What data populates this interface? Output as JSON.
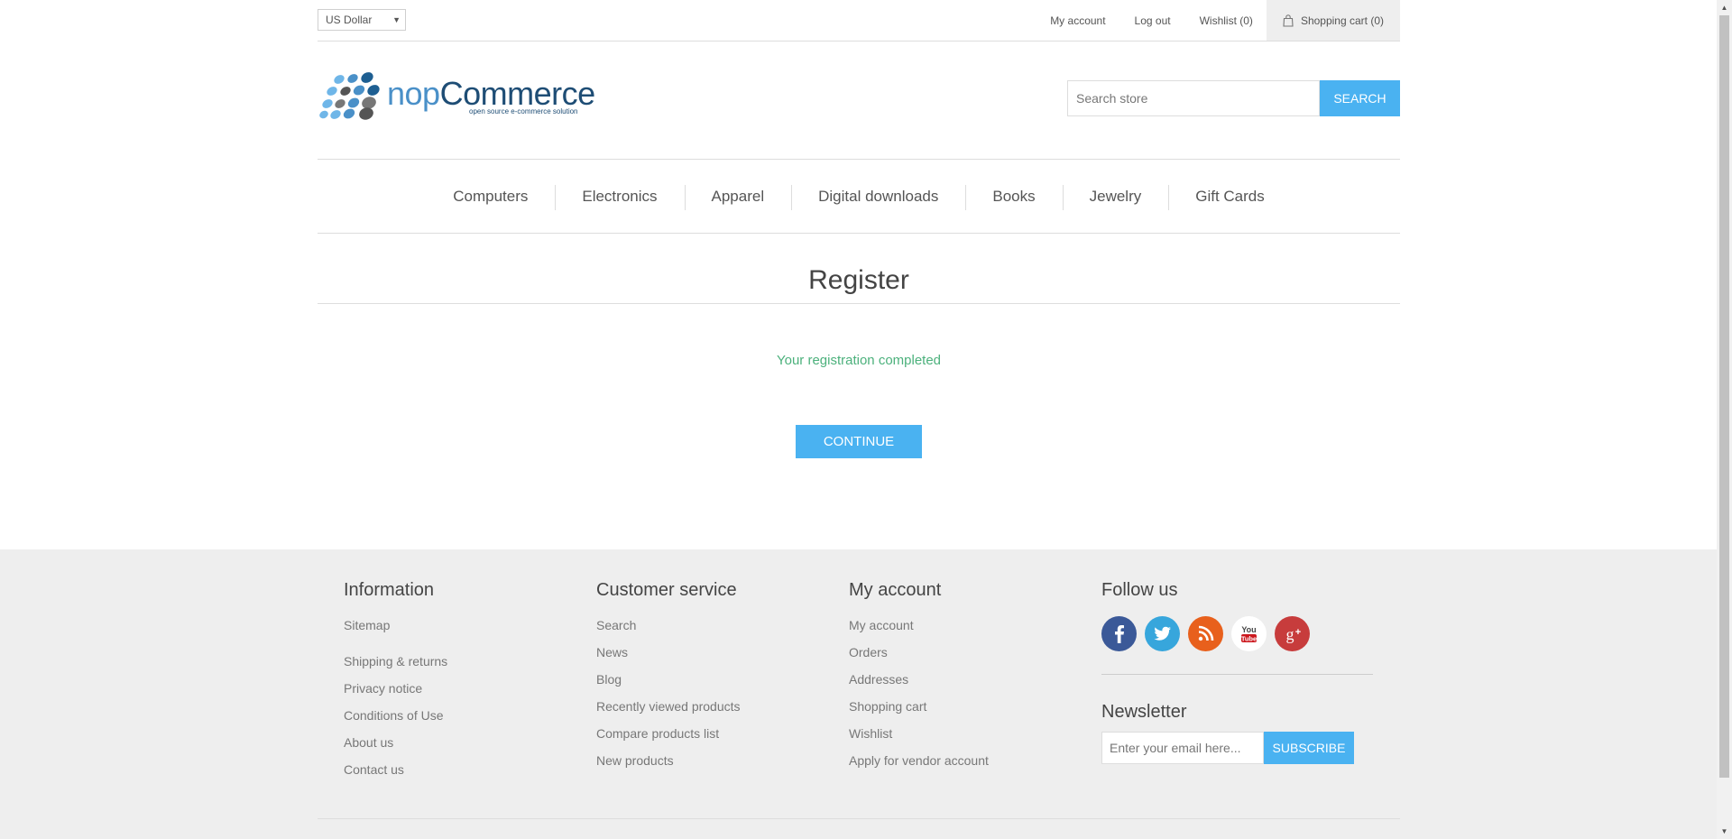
{
  "header": {
    "currency": "US Dollar",
    "links": {
      "my_account": "My account",
      "log_out": "Log out",
      "wishlist": "Wishlist (0)",
      "shopping_cart": "Shopping cart (0)"
    }
  },
  "logo": {
    "brand_prefix": "nop",
    "brand_suffix": "Commerce",
    "tagline": "open source e-commerce solution"
  },
  "search": {
    "placeholder": "Search store",
    "button": "Search"
  },
  "menu": [
    "Computers",
    "Electronics",
    "Apparel",
    "Digital downloads",
    "Books",
    "Jewelry",
    "Gift Cards"
  ],
  "page": {
    "title": "Register",
    "result": "Your registration completed",
    "continue_button": "Continue"
  },
  "footer": {
    "information": {
      "title": "Information",
      "links": [
        "Sitemap",
        "Shipping & returns",
        "Privacy notice",
        "Conditions of Use",
        "About us",
        "Contact us"
      ]
    },
    "customer_service": {
      "title": "Customer service",
      "links": [
        "Search",
        "News",
        "Blog",
        "Recently viewed products",
        "Compare products list",
        "New products"
      ]
    },
    "my_account": {
      "title": "My account",
      "links": [
        "My account",
        "Orders",
        "Addresses",
        "Shopping cart",
        "Wishlist",
        "Apply for vendor account"
      ]
    },
    "follow_us": {
      "title": "Follow us",
      "icons": [
        "facebook-icon",
        "twitter-icon",
        "rss-icon",
        "youtube-icon",
        "google-plus-icon"
      ]
    },
    "newsletter": {
      "title": "Newsletter",
      "placeholder": "Enter your email here...",
      "button": "Subscribe"
    }
  },
  "colors": {
    "accent": "#4ab2f1",
    "success": "#4cb17c",
    "footer_bg": "#eeeeee",
    "text": "#444444"
  }
}
